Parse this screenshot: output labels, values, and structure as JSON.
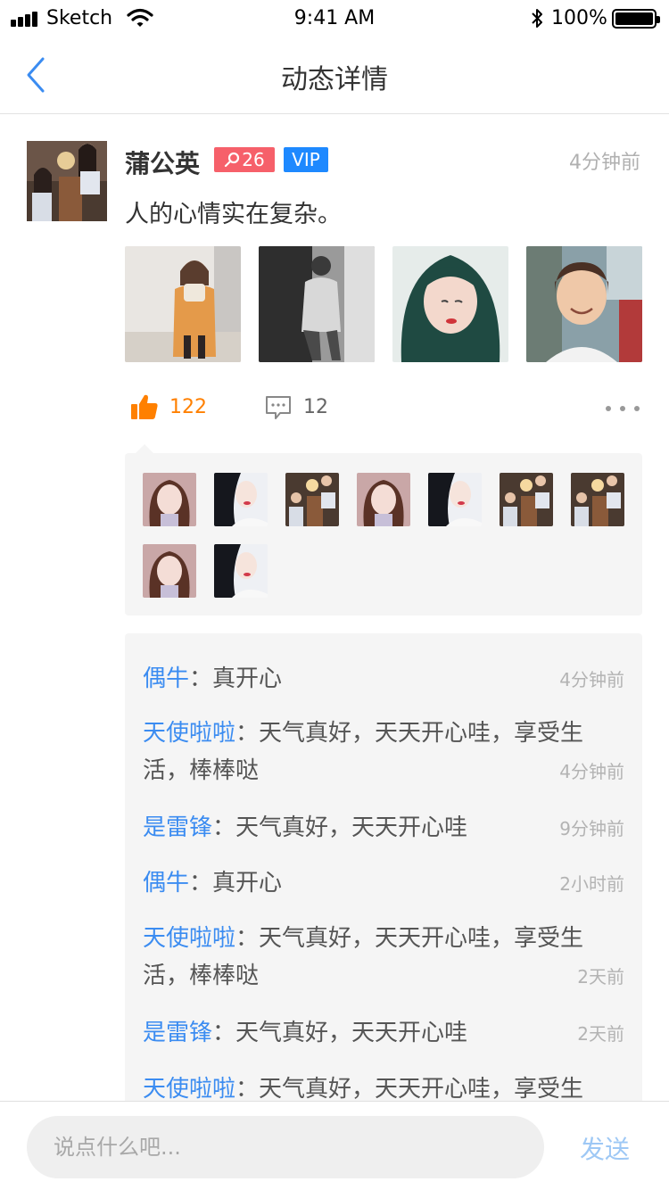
{
  "status_bar": {
    "carrier": "Sketch",
    "time": "9:41 AM",
    "battery": "100%"
  },
  "nav": {
    "title": "动态详情"
  },
  "post": {
    "author": "蒲公英",
    "age": "26",
    "vip": "VIP",
    "time": "4分钟前",
    "text": "人的心情实在复杂。",
    "photos": [
      {
        "icon": "photo-orange-coat"
      },
      {
        "icon": "photo-monochrome"
      },
      {
        "icon": "photo-green-hair"
      },
      {
        "icon": "photo-street-smile"
      }
    ],
    "likes": "122",
    "comments_count": "12"
  },
  "likers": [
    {
      "icon": "avatar-girl-lilac"
    },
    {
      "icon": "avatar-girl-dark"
    },
    {
      "icon": "avatar-girls-lamp"
    },
    {
      "icon": "avatar-girl-lilac"
    },
    {
      "icon": "avatar-girl-dark"
    },
    {
      "icon": "avatar-girls-lamp"
    },
    {
      "icon": "avatar-girls-lamp"
    },
    {
      "icon": "avatar-girl-lilac"
    },
    {
      "icon": "avatar-girl-dark"
    }
  ],
  "comments": [
    {
      "name": "偶牛",
      "sep": "：",
      "text": "真开心",
      "time": "4分钟前"
    },
    {
      "name": "天使啦啦",
      "sep": "：",
      "text": "天气真好，天天开心哇，享受生活，棒棒哒",
      "time": "4分钟前"
    },
    {
      "name": "是雷锋",
      "sep": "：",
      "text": "天气真好，天天开心哇",
      "time": "9分钟前"
    },
    {
      "name": "偶牛",
      "sep": "：",
      "text": "真开心",
      "time": "2小时前"
    },
    {
      "name": "天使啦啦",
      "sep": "：",
      "text": "天气真好，天天开心哇，享受生活，棒棒哒",
      "time": "2天前"
    },
    {
      "name": "是雷锋",
      "sep": "：",
      "text": "天气真好，天天开心哇",
      "time": "2天前"
    },
    {
      "name": "天使啦啦",
      "sep": "：",
      "text": "天气真好，天天开心哇，享受生",
      "time": ""
    }
  ],
  "input": {
    "placeholder": "说点什么吧...",
    "send": "发送"
  },
  "colors": {
    "accent": "#3b8cf1",
    "like": "#ff8000",
    "age_badge": "#f6606a",
    "vip_badge": "#1e89ff"
  }
}
